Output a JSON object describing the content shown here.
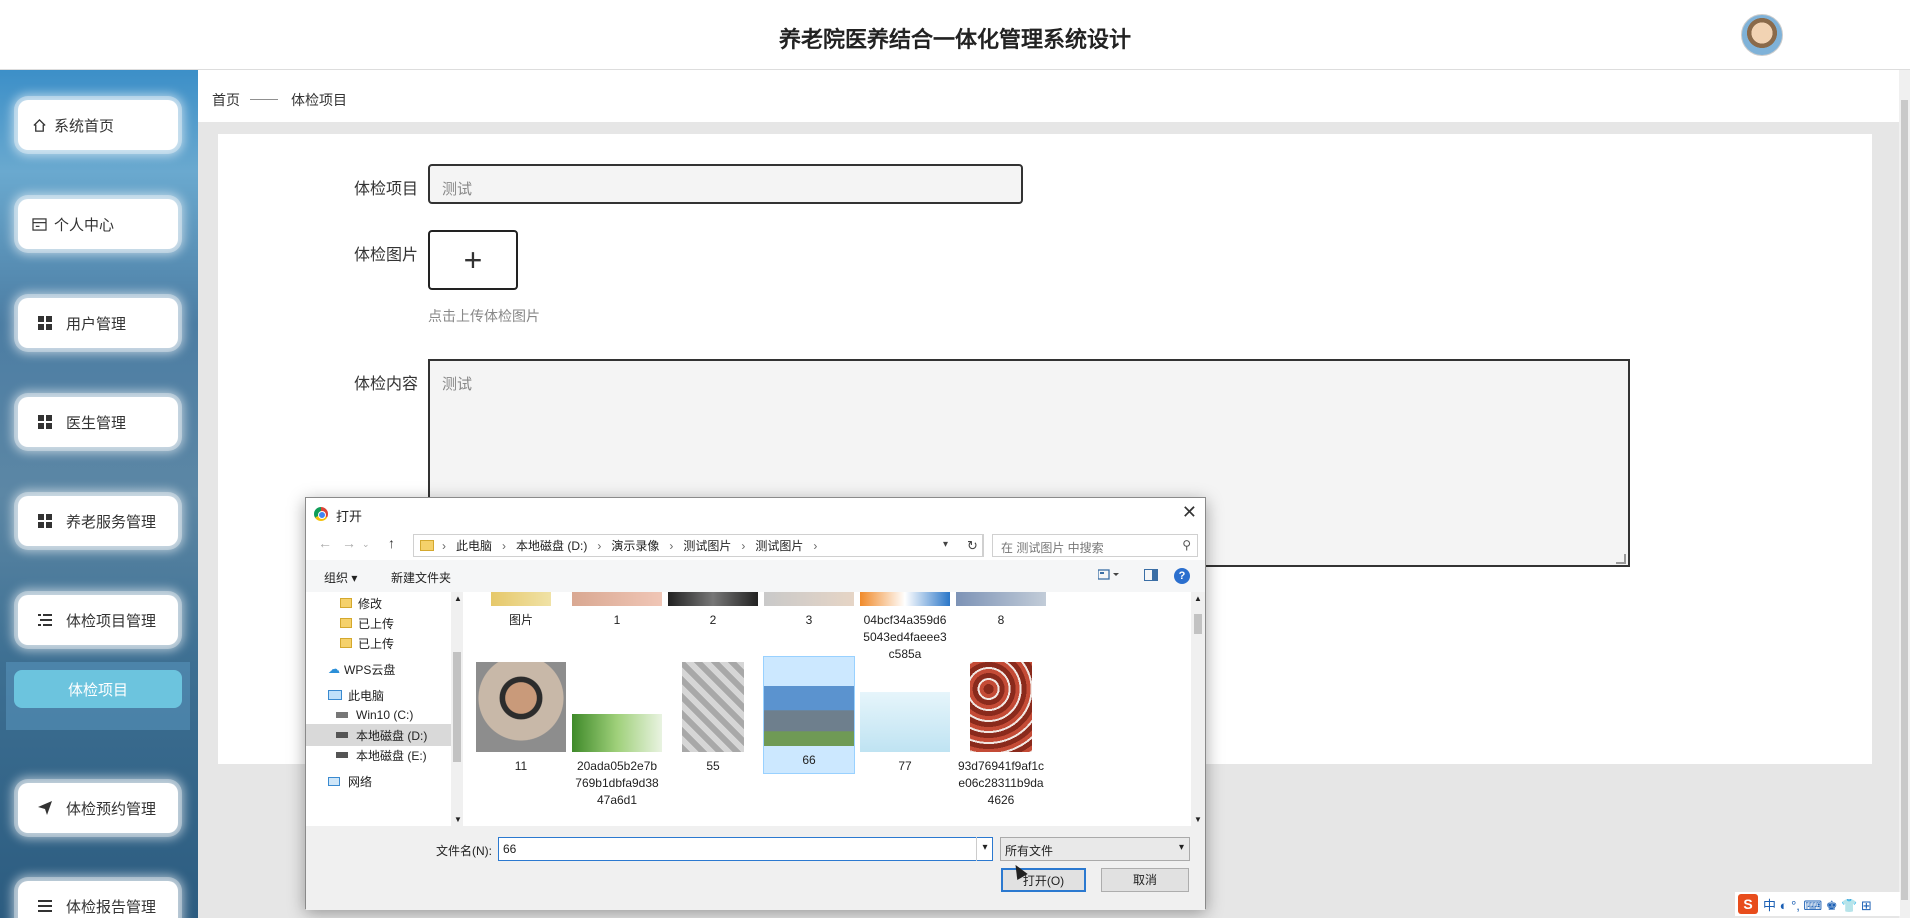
{
  "header": {
    "title": "养老院医养结合一体化管理系统设计"
  },
  "sidebar": {
    "items": [
      {
        "label": "系统首页",
        "icon": "home-icon"
      },
      {
        "label": "个人中心",
        "icon": "card-icon"
      },
      {
        "label": "用户管理",
        "icon": "grid-icon"
      },
      {
        "label": "医生管理",
        "icon": "grid-icon"
      },
      {
        "label": "养老服务管理",
        "icon": "grid-icon"
      },
      {
        "label": "体检项目管理",
        "icon": "list-icon"
      },
      {
        "label": "体检预约管理",
        "icon": "send-icon"
      },
      {
        "label": "体检报告管理",
        "icon": "list-icon"
      }
    ],
    "sub_item": "体检项目"
  },
  "breadcrumb": {
    "home": "首页",
    "sep": "——",
    "current": "体检项目"
  },
  "form": {
    "item_label": "体检项目",
    "item_value": "测试",
    "image_label": "体检图片",
    "upload_plus": "+",
    "upload_hint": "点击上传体检图片",
    "content_label": "体检内容",
    "content_value": "测试"
  },
  "dialog": {
    "title": "打开",
    "close": "✕",
    "path": [
      "此电脑",
      "本地磁盘 (D:)",
      "演示录像",
      "测试图片",
      "测试图片"
    ],
    "search_placeholder": "在 测试图片 中搜索",
    "organize": "组织 ▾",
    "new_folder": "新建文件夹",
    "help": "?",
    "tree": [
      {
        "label": "修改",
        "type": "folder"
      },
      {
        "label": "已上传",
        "type": "folder"
      },
      {
        "label": "已上传",
        "type": "folder"
      },
      {
        "label": "WPS云盘",
        "type": "cloud"
      },
      {
        "label": "此电脑",
        "type": "pc"
      },
      {
        "label": "Win10 (C:)",
        "type": "drive"
      },
      {
        "label": "本地磁盘 (D:)",
        "type": "drive",
        "selected": true
      },
      {
        "label": "本地磁盘 (E:)",
        "type": "drive"
      },
      {
        "label": "网络",
        "type": "network"
      }
    ],
    "files_row1": [
      "图片",
      "1",
      "2",
      "3",
      "04bcf34a359d6\n5043ed4faeee3\nc585a",
      "8"
    ],
    "files_row2": [
      "11",
      "20ada05b2e7b\n769b1dbfa9d38\n47a6d1",
      "55",
      "66",
      "77",
      "93d76941f9af1c\ne06c28311b9da\n4626"
    ],
    "selected_file": "66",
    "filename_label": "文件名(N):",
    "filename_value": "66",
    "filetype": "所有文件",
    "open_btn": "打开(O)",
    "cancel_btn": "取消"
  },
  "ime": {
    "logo": "S",
    "text": "中 ◐ °, ⌨ ♚ 👕 ⊞"
  }
}
